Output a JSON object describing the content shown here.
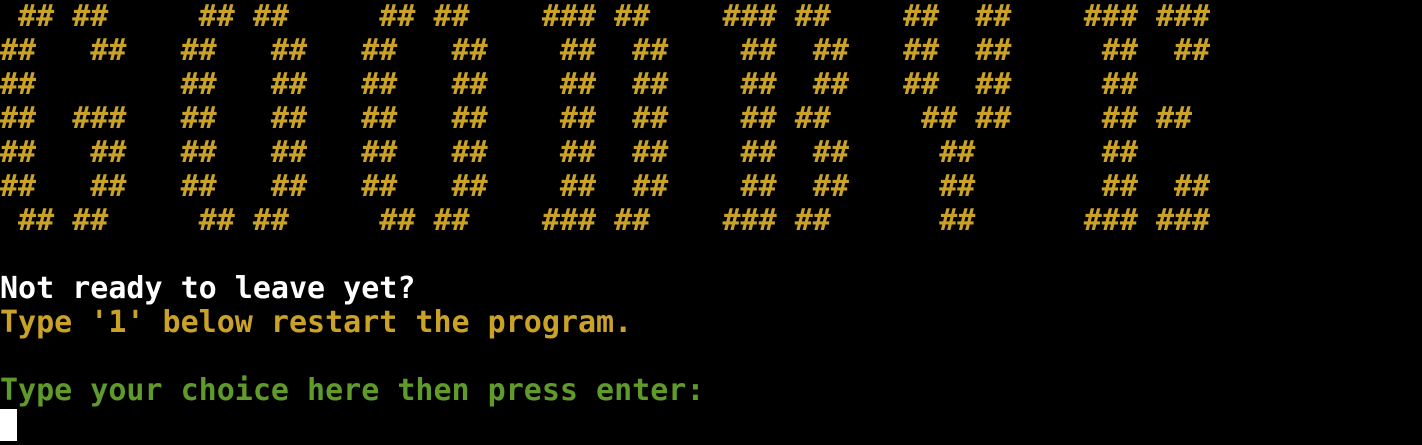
{
  "terminal": {
    "banner_lines": [
      " ## ##     ## ##     ## ##    ### ##    ### ##    ##  ##    ### ###",
      "##   ##   ##   ##   ##   ##    ##  ##    ##  ##   ##  ##     ##  ##",
      "##        ##   ##   ##   ##    ##  ##    ##  ##   ##  ##     ##",
      "##  ###   ##   ##   ##   ##    ##  ##    ## ##     ## ##     ## ##",
      "##   ##   ##   ##   ##   ##    ##  ##    ##  ##     ##       ##",
      "##   ##   ##   ##   ##   ##    ##  ##    ##  ##     ##       ##  ##",
      " ## ##     ## ##     ## ##    ### ##    ### ##      ##      ### ###"
    ],
    "prompt_question": "Not ready to leave yet?",
    "instruction": "Type '1' below restart the program.",
    "input_prompt": "Type your choice here then press enter:",
    "input_value": "",
    "colors": {
      "background": "#000000",
      "banner": "#c9a227",
      "question": "#ffffff",
      "instruction": "#c9a227",
      "prompt": "#5f9a2a",
      "cursor": "#ffffff"
    }
  }
}
